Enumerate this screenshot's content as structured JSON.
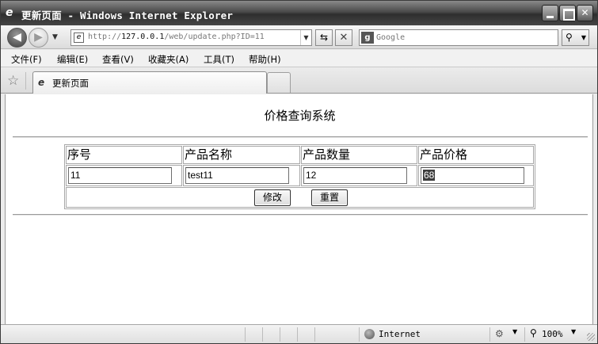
{
  "window": {
    "title": "更新页面 - Windows Internet Explorer"
  },
  "navbar": {
    "address_prefix": "http://",
    "address_host": "127.0.0.1",
    "address_path": "/web/update.php?ID=11",
    "search_placeholder": "Google"
  },
  "menu": {
    "items": [
      "文件(F)",
      "编辑(E)",
      "查看(V)",
      "收藏夹(A)",
      "工具(T)",
      "帮助(H)"
    ]
  },
  "tab": {
    "label": "更新页面"
  },
  "page": {
    "heading": "价格查询系统",
    "columns": [
      "序号",
      "产品名称",
      "产品数量",
      "产品价格"
    ],
    "fields": {
      "id": "11",
      "name": "test11",
      "quantity": "12",
      "price": "68"
    },
    "submit_label": "修改",
    "reset_label": "重置"
  },
  "status": {
    "zone": "Internet",
    "zoom": "100%"
  }
}
